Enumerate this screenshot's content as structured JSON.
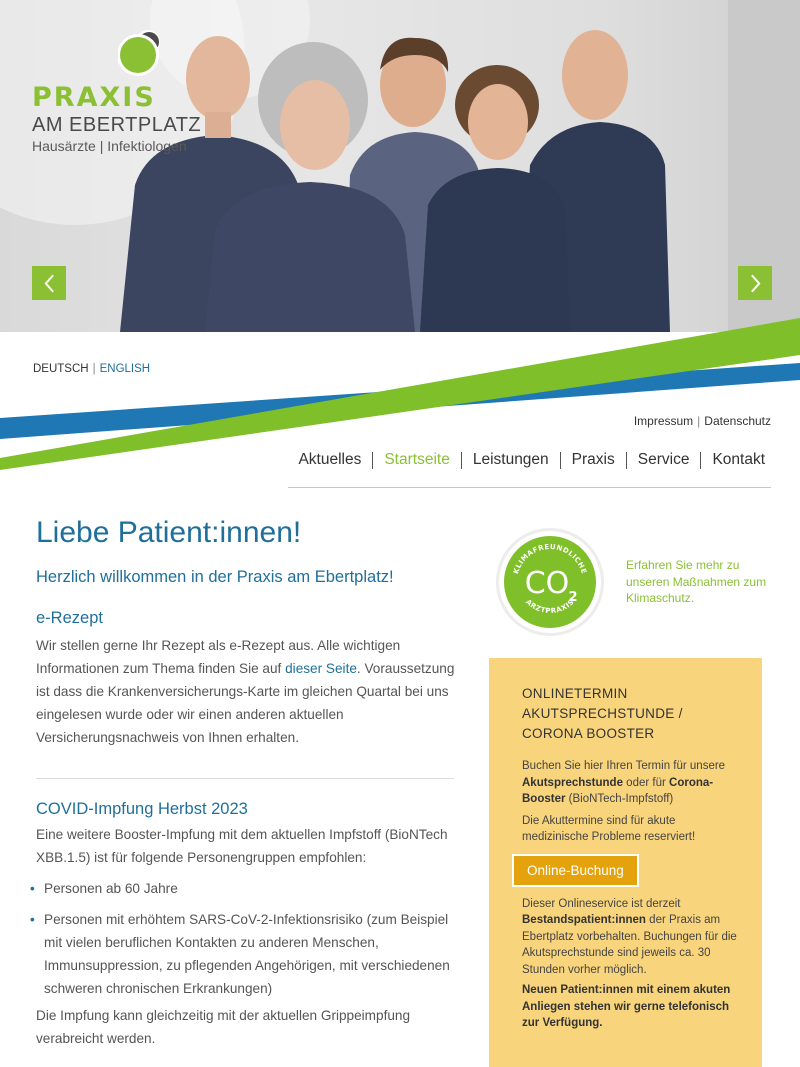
{
  "logo": {
    "title": "PRAXIS",
    "subtitle_1": "AM EBERTPLATZ",
    "subtitle_2": "Hausärzte | Infektiologen"
  },
  "hero": {
    "prev_icon": "chevron-left-icon",
    "next_icon": "chevron-right-icon"
  },
  "language": {
    "german": "DEUTSCH",
    "separator": "|",
    "english": "ENGLISH"
  },
  "meta_links": {
    "impressum": "Impressum",
    "separator": "|",
    "datenschutz": "Datenschutz"
  },
  "nav": {
    "items": [
      {
        "label": "Aktuelles"
      },
      {
        "label": "Startseite"
      },
      {
        "label": "Leistungen"
      },
      {
        "label": "Praxis"
      },
      {
        "label": "Service"
      },
      {
        "label": "Kontakt"
      }
    ],
    "active": "Startseite"
  },
  "content": {
    "heading": "Liebe Patient:innen!",
    "welcome": "Herzlich willkommen in der Praxis am Ebertplatz!",
    "erezept": {
      "title": "e-Rezept",
      "text_1": "Wir stellen gerne Ihr Rezept als e-Rezept aus. Alle wichtigen Informationen zum Thema finden Sie auf",
      "link": "dieser Seite",
      "text_2": ". Voraussetzung ist dass die Krankenversicherungs-Karte im gleichen Quartal bei uns eingelesen wurde oder wir einen anderen aktuellen Versicherungsnachweis von Ihnen erhalten."
    },
    "covid": {
      "title": "COVID-Impfung Herbst 2023",
      "intro": "Eine weitere Booster-Impfung mit dem aktuellen Impfstoff (BioNTech XBB.1.5) ist für folgende Personengruppen empfohlen:",
      "bullets": [
        "Personen ab 60 Jahre",
        "Personen mit erhöhtem SARS-CoV-2-Infektionsrisiko (zum Beispiel mit vielen beruflichen Kontakten zu anderen Menschen, Immunsuppression, zu pflegenden Angehörigen, mit verschiedenen schweren chronischen Erkrankungen)"
      ],
      "outro": "Die Impfung kann gleichzeitig mit der aktuellen Grippeimpfung verabreicht werden."
    }
  },
  "klima": {
    "badge_top": "KLIMAFREUNDLICHE",
    "badge_bottom": "ARZTPRAXIS",
    "badge_center": "CO",
    "badge_sub": "2",
    "text": "Erfahren Sie mehr zu unseren Maßnahmen zum Klimaschutz."
  },
  "booking": {
    "title": "ONLINETERMIN AKUTSPRECHSTUNDE / CORONA BOOSTER",
    "p1_a": "Buchen Sie hier Ihren Termin für unsere",
    "p1_b": "Akutsprechstunde",
    "p1_c": "oder für",
    "p1_d": "Corona-Booster",
    "p1_e": "(BioNTech-Impfstoff)",
    "p2": "Die Akuttermine sind für akute medizinische Probleme reserviert!",
    "button": "Online-Buchung",
    "p3_a": "Dieser Onlineservice ist derzeit",
    "p3_b": "Bestandspatient:innen",
    "p3_c": "der Praxis am Ebertplatz vorbehalten. Buchungen für die Akutsprechstunde sind jeweils ca. 30 Stunden vorher möglich.",
    "p4": "Neuen Patient:innen mit einem akuten Anliegen stehen wir gerne telefonisch zur Verfügung."
  },
  "colors": {
    "brand_green": "#8bc034",
    "brand_blue": "#1f6f9b",
    "box_yellow": "#f8d47c",
    "button_orange": "#e4a20d"
  }
}
